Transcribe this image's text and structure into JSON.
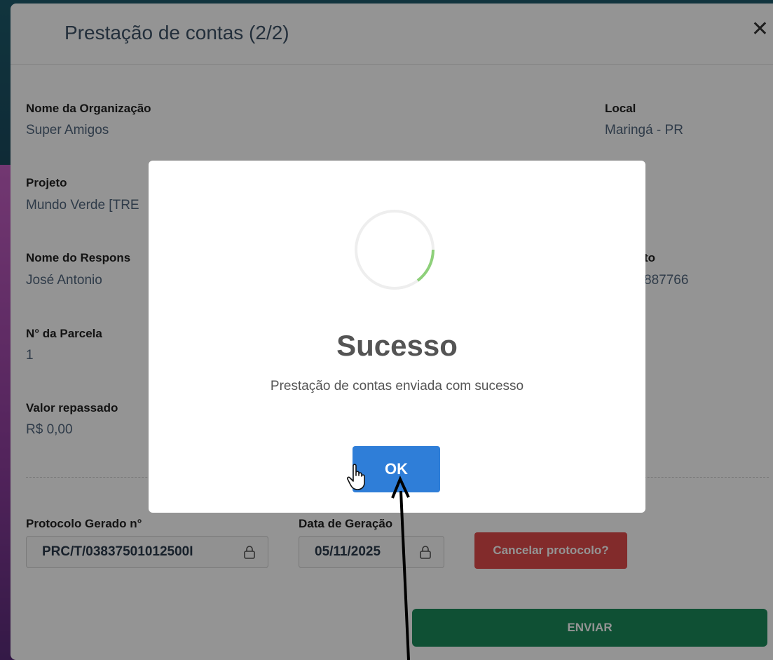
{
  "main_modal": {
    "title": "Prestação de contas (2/2)",
    "fields": {
      "org_label": "Nome da Organização",
      "org_value": "Super Amigos",
      "local_label": "Local",
      "local_value": "Maringá - PR",
      "project_label": "Projeto",
      "project_value": "Mundo Verde [TRE",
      "responsible_label": "Nome do Respons",
      "responsible_value": "José Antonio",
      "contact_label_partial": "to",
      "contact_value_partial": "887766",
      "installment_label": "N° da Parcela",
      "installment_value": "1",
      "amount_label": "Valor repassado",
      "amount_value": "R$ 0,00"
    },
    "protocol": {
      "label": "Protocolo Gerado n°",
      "value": "PRC/T/03837501012500I"
    },
    "date": {
      "label": "Data de Geração",
      "value": "05/11/2025"
    },
    "cancel_button": "Cancelar protocolo?",
    "send_button": "ENVIAR"
  },
  "dialog": {
    "title": "Sucesso",
    "message": "Prestação de contas enviada com sucesso",
    "ok_button": "OK"
  },
  "colors": {
    "ok_button": "#2f7ed8",
    "cancel_button": "#e04b4b",
    "send_button": "#1a8a5a",
    "spinner_arc": "#8ed07a"
  },
  "icons": [
    "close-icon",
    "lock-icon",
    "hand-cursor-icon",
    "annotation-arrow"
  ]
}
